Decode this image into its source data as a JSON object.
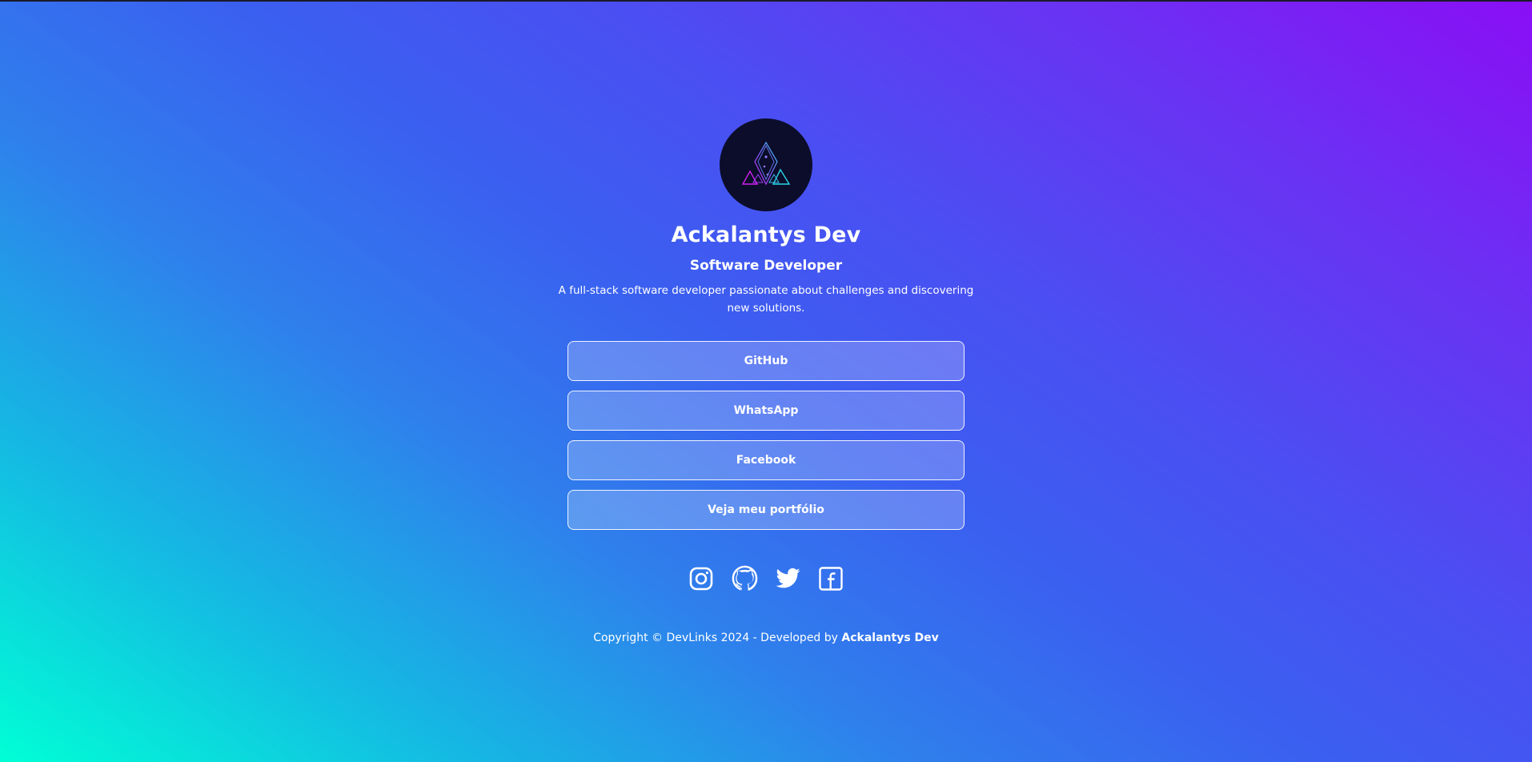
{
  "profile": {
    "name": "Ackalantys Dev",
    "role": "Software Developer",
    "bio": "A full-stack software developer passionate about challenges and discovering new solutions."
  },
  "links": [
    {
      "label": "GitHub"
    },
    {
      "label": "WhatsApp"
    },
    {
      "label": "Facebook"
    },
    {
      "label": "Veja meu portfólio"
    }
  ],
  "socials": [
    {
      "icon": "instagram-icon"
    },
    {
      "icon": "github-icon"
    },
    {
      "icon": "twitter-icon"
    },
    {
      "icon": "facebook-icon"
    }
  ],
  "footer": {
    "text": "Copyright © DevLinks 2024 - Developed by",
    "author": "Ackalantys Dev"
  },
  "colors": {
    "gradient_start": "#00ffd5",
    "gradient_mid": "#3a60f0",
    "gradient_end": "#8a0ef5",
    "avatar_bg": "#0b0d2a"
  }
}
